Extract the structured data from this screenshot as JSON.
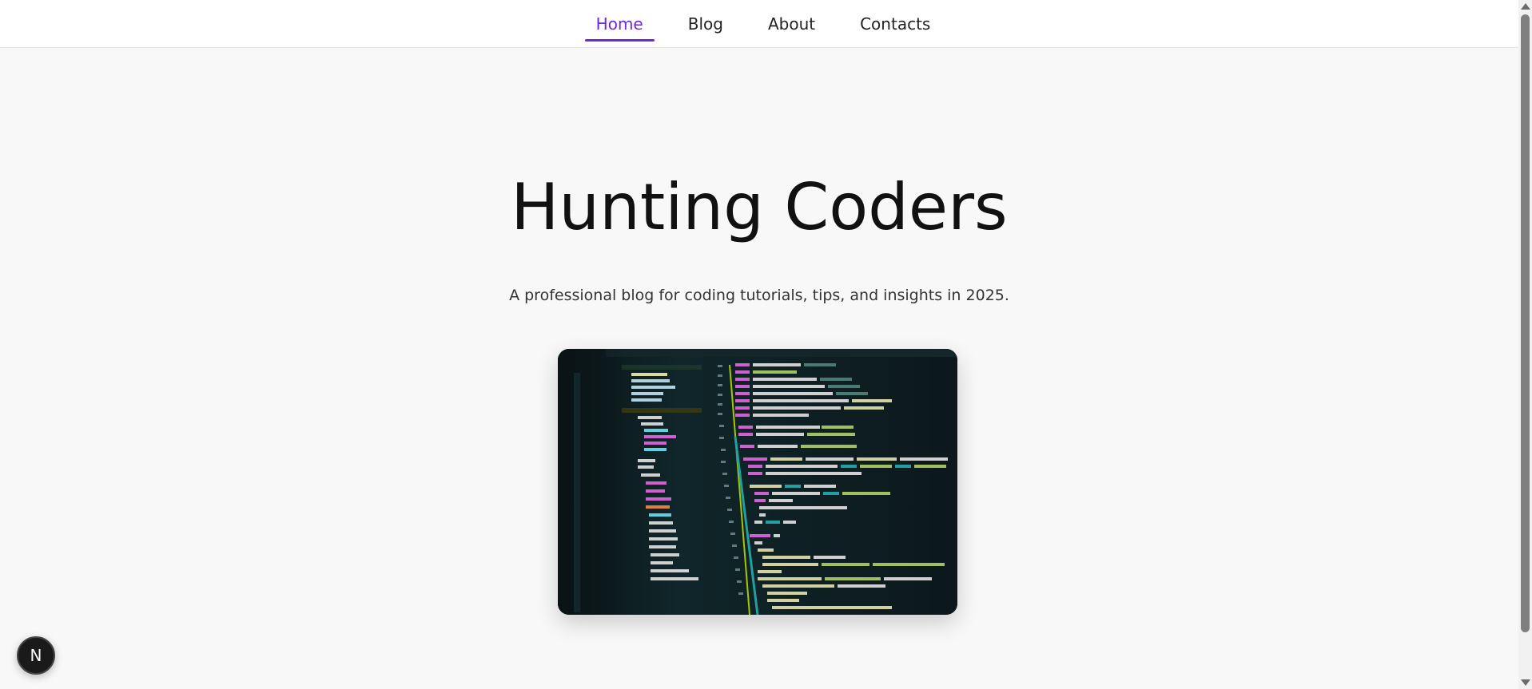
{
  "nav": {
    "items": [
      {
        "label": "Home",
        "active": true
      },
      {
        "label": "Blog",
        "active": false
      },
      {
        "label": "About",
        "active": false
      },
      {
        "label": "Contacts",
        "active": false
      }
    ],
    "accent_color": "#6d28d9"
  },
  "hero": {
    "title": "Hunting Coders",
    "subtitle": "A professional blog for coding tutorials, tips, and insights in 2025."
  },
  "badge": {
    "letter": "N"
  },
  "icons": {
    "next_badge": "nextjs-logo-icon",
    "scroll_up": "scroll-up-arrow-icon",
    "scroll_down": "scroll-down-arrow-icon"
  }
}
